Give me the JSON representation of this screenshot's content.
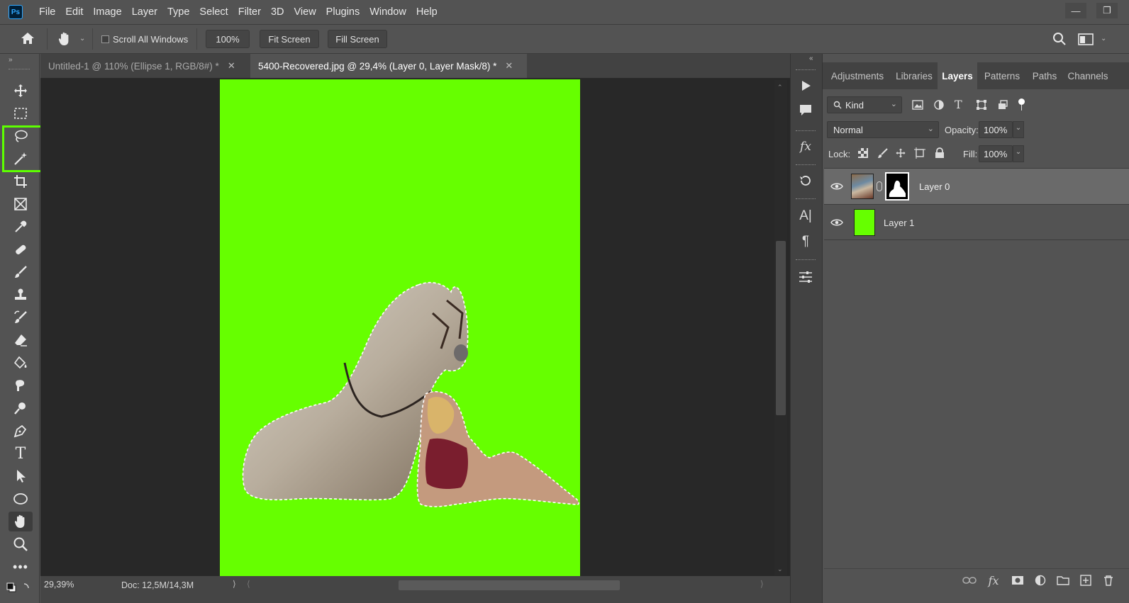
{
  "app": {
    "logo_text": "Ps"
  },
  "menu": [
    "File",
    "Edit",
    "Image",
    "Layer",
    "Type",
    "Select",
    "Filter",
    "3D",
    "View",
    "Plugins",
    "Window",
    "Help"
  ],
  "options_bar": {
    "scroll_all_windows_label": "Scroll All Windows",
    "scroll_all_windows_checked": false,
    "zoom_value": "100%",
    "fit_screen_label": "Fit Screen",
    "fill_screen_label": "Fill Screen"
  },
  "tabs": [
    {
      "title": "Untitled-1 @ 110% (Ellipse 1, RGB/8#) *",
      "active": false
    },
    {
      "title": "5400-Recovered.jpg @ 29,4% (Layer 0, Layer Mask/8) *",
      "active": true
    }
  ],
  "status": {
    "zoom": "29,39%",
    "doc": "Doc: 12,5M/14,3M"
  },
  "panel_tabs": [
    {
      "label": "Adjustments",
      "active": false
    },
    {
      "label": "Libraries",
      "active": false
    },
    {
      "label": "Layers",
      "active": true
    },
    {
      "label": "Patterns",
      "active": false
    },
    {
      "label": "Paths",
      "active": false
    },
    {
      "label": "Channels",
      "active": false
    }
  ],
  "layers_panel": {
    "filter_kind": "Kind",
    "blend_mode": "Normal",
    "opacity_label": "Opacity:",
    "opacity_value": "100%",
    "lock_label": "Lock:",
    "fill_label": "Fill:",
    "fill_value": "100%",
    "layers": [
      {
        "name": "Layer 0",
        "visible": true,
        "selected": true,
        "has_mask": true
      },
      {
        "name": "Layer 1",
        "visible": true,
        "selected": false,
        "has_mask": false
      }
    ]
  },
  "colors": {
    "canvas_fill": "#66ff00",
    "highlight_box": "#5dff00",
    "app_bg": "#535353"
  },
  "icons": {
    "tools": [
      "move-icon",
      "marquee-icon",
      "lasso-icon",
      "magic-wand-icon",
      "crop-icon",
      "frame-icon",
      "eyedropper-icon",
      "healing-brush-icon",
      "brush-icon",
      "clone-stamp-icon",
      "history-brush-icon",
      "eraser-icon",
      "paint-bucket-icon",
      "smudge-icon",
      "dodge-icon",
      "pen-icon",
      "type-icon",
      "path-selection-icon",
      "ellipse-icon",
      "hand-icon",
      "zoom-icon",
      "more-tools-icon"
    ]
  }
}
